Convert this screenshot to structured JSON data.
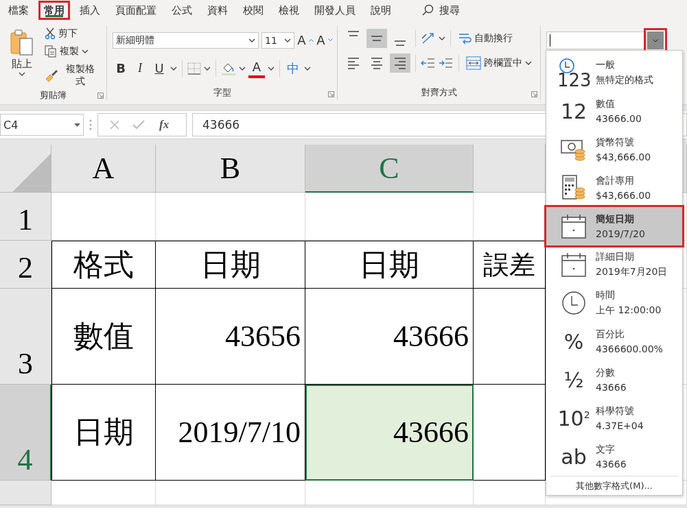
{
  "menu_tabs": [
    {
      "label": "檔案",
      "selected": false
    },
    {
      "label": "常用",
      "selected": true
    },
    {
      "label": "插入",
      "selected": false
    },
    {
      "label": "頁面配置",
      "selected": false
    },
    {
      "label": "公式",
      "selected": false
    },
    {
      "label": "資料",
      "selected": false
    },
    {
      "label": "校閱",
      "selected": false
    },
    {
      "label": "檢視",
      "selected": false
    },
    {
      "label": "開發人員",
      "selected": false
    },
    {
      "label": "說明",
      "selected": false
    }
  ],
  "search": {
    "label": "搜尋"
  },
  "clipboard": {
    "paste": "貼上",
    "cut": "剪下",
    "copy": "複製",
    "format_painter": "複製格式",
    "label": "剪貼簿"
  },
  "font": {
    "name": "新細明體",
    "size": "11",
    "grow": "A",
    "shrink": "A",
    "bold": "B",
    "italic": "I",
    "underline": "U",
    "font_color": "A",
    "phonetic": "中",
    "label": "字型"
  },
  "alignment": {
    "vertical": [
      {
        "kind": "top",
        "selected": false
      },
      {
        "kind": "middle",
        "selected": true
      },
      {
        "kind": "bottom",
        "selected": false
      }
    ],
    "horizontal": [
      {
        "kind": "left",
        "selected": false
      },
      {
        "kind": "center",
        "selected": false
      },
      {
        "kind": "right",
        "selected": true
      }
    ],
    "wrap_text": "自動換行",
    "merge_center": "跨欄置中",
    "label": "對齊方式"
  },
  "number_format": {
    "open": true
  },
  "formula_bar": {
    "name_box": "C4",
    "function_label": "fx",
    "formula": "43666"
  },
  "sheet": {
    "columns": [
      {
        "label": "A",
        "selected": false
      },
      {
        "label": "B",
        "selected": false
      },
      {
        "label": "C",
        "selected": true
      }
    ],
    "rows": [
      {
        "label": "1",
        "selected": false
      },
      {
        "label": "2",
        "selected": false,
        "cells": [
          {
            "kind": "label",
            "text": "格式",
            "selected": false
          },
          {
            "kind": "label",
            "text": "日期",
            "selected": false
          },
          {
            "kind": "label",
            "text": "日期",
            "selected": false
          },
          {
            "kind": "label",
            "text": "誤差",
            "selected": false
          }
        ]
      },
      {
        "label": "3",
        "selected": false,
        "cells": [
          {
            "kind": "label",
            "text": "數值",
            "selected": false
          },
          {
            "kind": "number",
            "text": "43656",
            "selected": false
          },
          {
            "kind": "number",
            "text": "43666",
            "selected": false
          },
          {
            "kind": "empty",
            "selected": false
          }
        ]
      },
      {
        "label": "4",
        "selected": true,
        "cells": [
          {
            "kind": "label",
            "text": "日期",
            "selected": false
          },
          {
            "kind": "number",
            "text": "2019/7/10",
            "selected": false
          },
          {
            "kind": "number",
            "text": "43666",
            "selected": true
          },
          {
            "kind": "empty",
            "selected": false
          }
        ]
      }
    ]
  },
  "format_menu": {
    "items": [
      {
        "kind": "general",
        "icon_text": "123",
        "title": "一般",
        "sample": "無特定的格式",
        "selected": false
      },
      {
        "kind": "number",
        "icon_text": "12",
        "title": "數值",
        "sample": "43666.00",
        "selected": false
      },
      {
        "kind": "currency",
        "title": "貨幣符號",
        "sample": "$43,666.00",
        "selected": false
      },
      {
        "kind": "accounting",
        "title": "會計專用",
        "sample": "$43,666.00",
        "selected": false
      },
      {
        "kind": "date_short",
        "title": "簡短日期",
        "sample": "2019/7/20",
        "selected": true
      },
      {
        "kind": "date_long",
        "title": "詳細日期",
        "sample": "2019年7月20日",
        "selected": false
      },
      {
        "kind": "time",
        "title": "時間",
        "sample": "上午 12:00:00",
        "selected": false
      },
      {
        "kind": "percent",
        "icon_text": "%",
        "title": "百分比",
        "sample": "4366600.00%",
        "selected": false
      },
      {
        "kind": "fraction",
        "icon_text": "½",
        "title": "分數",
        "sample": "43666",
        "selected": false
      },
      {
        "kind": "scientific",
        "icon_text": "10$^{2}$",
        "title": "科學符號",
        "sample": "4.37E+04",
        "selected": false
      },
      {
        "kind": "text",
        "icon_text": "ab",
        "title": "文字",
        "sample": "43666",
        "selected": false
      }
    ],
    "more": "其他數字格式(M)..."
  }
}
